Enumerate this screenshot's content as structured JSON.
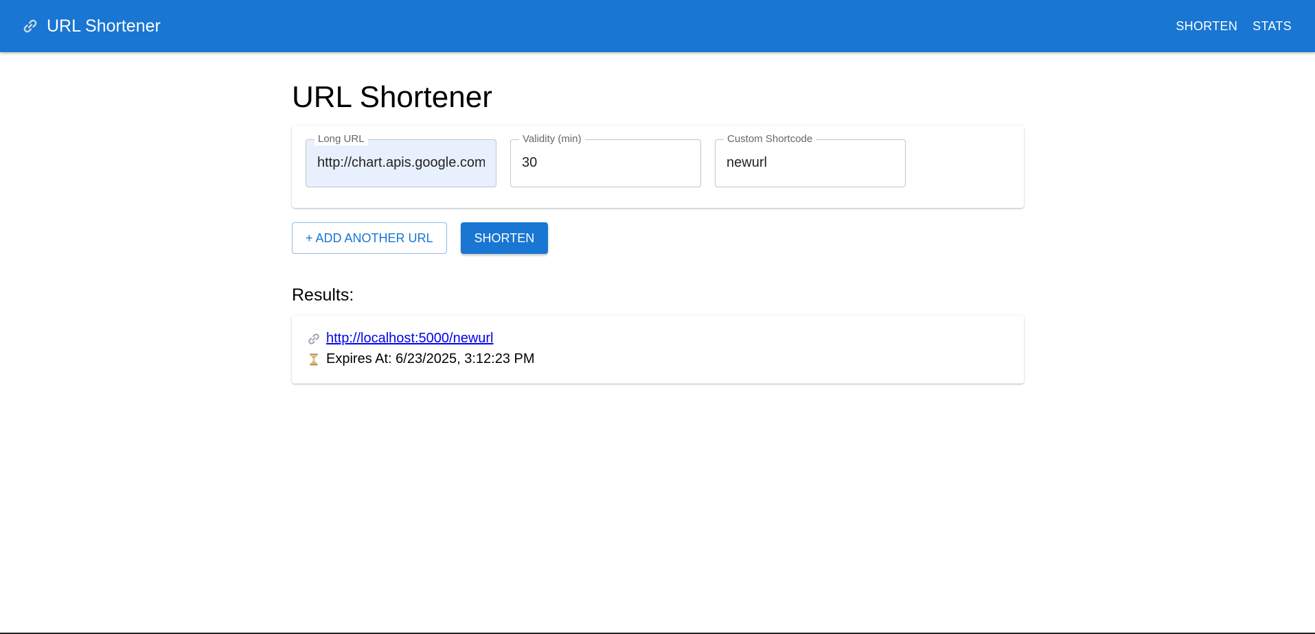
{
  "appbar": {
    "title": "URL Shortener",
    "icon": "link-icon",
    "nav": [
      {
        "label": "SHORTEN"
      },
      {
        "label": "STATS"
      }
    ],
    "color": "#1976d2"
  },
  "page": {
    "title": "URL Shortener"
  },
  "form": {
    "long_url": {
      "label": "Long URL",
      "value": "http://chart.apis.google.com"
    },
    "validity": {
      "label": "Validity (min)",
      "value": "30"
    },
    "shortcode": {
      "label": "Custom Shortcode",
      "value": "newurl"
    }
  },
  "actions": {
    "add_label": "+ ADD ANOTHER URL",
    "shorten_label": "SHORTEN"
  },
  "results": {
    "heading": "Results:",
    "items": [
      {
        "short_url": "http://localhost:5000/newurl",
        "expires": "Expires At: 6/23/2025, 3:12:23 PM",
        "link_icon": "link-icon",
        "expiry_icon": "hourglass-icon"
      }
    ]
  }
}
